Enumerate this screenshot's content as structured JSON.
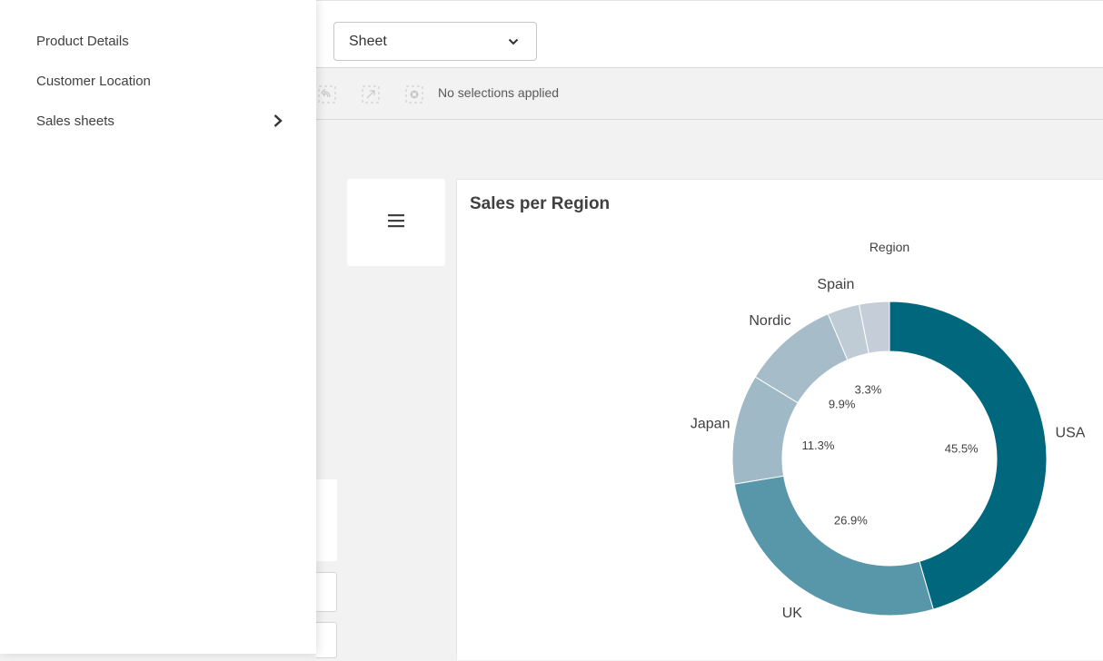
{
  "nav": {
    "items": [
      {
        "label": "Product Details"
      },
      {
        "label": "Customer Location"
      },
      {
        "label": "Sales sheets"
      }
    ]
  },
  "header": {
    "sheet_dropdown": {
      "value": "Sheet"
    }
  },
  "selections": {
    "status_text": "No selections applied"
  },
  "colors": {
    "usa": "#00677d",
    "uk": "#5896a9",
    "japan": "#9fbac6",
    "nordic": "#a6bdc9",
    "spain": "#bfccd6",
    "other": "#c5ced8"
  },
  "chart_data": {
    "type": "pie",
    "variant": "donut",
    "title": "Sales per Region",
    "legend_title": "Region",
    "slices": [
      {
        "label": "USA",
        "value": 45.5,
        "value_label": "45.5%"
      },
      {
        "label": "UK",
        "value": 26.9,
        "value_label": "26.9%"
      },
      {
        "label": "Japan",
        "value": 11.3,
        "value_label": "11.3%"
      },
      {
        "label": "Nordic",
        "value": 9.9,
        "value_label": "9.9%"
      },
      {
        "label": "Spain",
        "value": 3.3,
        "value_label": "3.3%"
      },
      {
        "label": "",
        "value": 3.1,
        "value_label": ""
      }
    ]
  }
}
